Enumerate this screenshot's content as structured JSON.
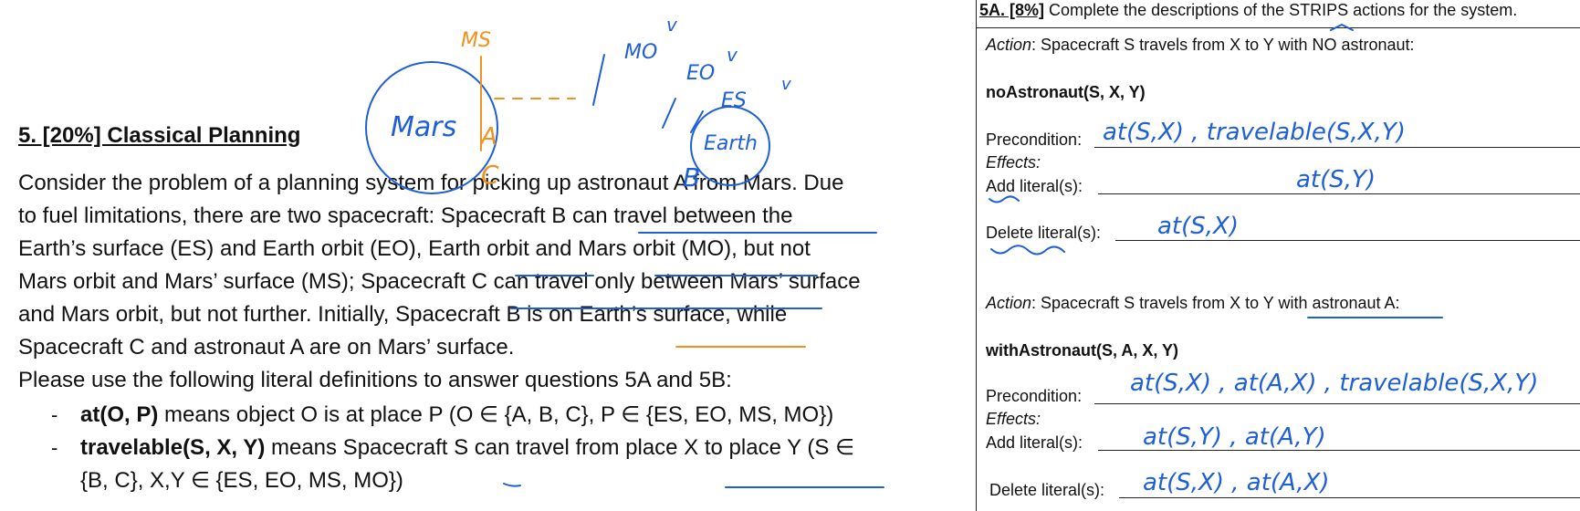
{
  "question": {
    "title": "5. [20%] Classical Planning",
    "paragraph": [
      "Consider the problem of a planning system for picking up astronaut A from Mars. Due",
      "to fuel limitations, there are two spacecraft: Spacecraft B can travel between the",
      "Earth’s surface (ES) and Earth orbit (EO), Earth orbit and Mars orbit (MO), but not",
      "Mars orbit and Mars’ surface (MS); Spacecraft C can travel only between Mars’ surface",
      "and Mars orbit, but not further. Initially, Spacecraft B is on Earth’s surface, while",
      "Spacecraft C and astronaut A are on Mars’ surface."
    ],
    "instruction": "Please use the following literal definitions to answer questions 5A and 5B:",
    "bullets": [
      {
        "dash": "-",
        "term": "at(O, P)",
        "text": " means object O is at place P (O ∈ {A, B, C}, P ∈ {ES, EO, MS, MO})"
      },
      {
        "dash": "-",
        "term": "travelable(S, X, Y)",
        "text": " means Spacecraft S can travel from place X to place Y (S ∈"
      }
    ],
    "bullet_cont": "{B, C}, X,Y ∈ {ES, EO, MS, MO})"
  },
  "sketch": {
    "mars": "Mars",
    "earth": "Earth",
    "ms": "MS",
    "mo": "MO",
    "eo": "EO",
    "es": "ES",
    "a": "A",
    "b": "B",
    "c": "C",
    "check": "v"
  },
  "panel": {
    "header_num": "5A. [8%]",
    "header_text": " Complete the descriptions of the STRIPS actions for the system.",
    "action1": {
      "label": "Action",
      "desc": ": Spacecraft S travels from X to Y with NO astronaut:"
    },
    "op1": "noAstronaut(S, X, Y)",
    "action2": {
      "label": "Action",
      "desc": ": Spacecraft S travels from X to Y with astronaut A:"
    },
    "op2": "withAstronaut(S, A, X, Y)",
    "labels": {
      "precondition": "Precondition:",
      "effects": "Effects:",
      "add": "Add literal(s):",
      "delete": "Delete literal(s):"
    },
    "answers1": {
      "pre": "at(S,X) , travelable(S,X,Y)",
      "add": "at(S,Y)",
      "del": "at(S,X)"
    },
    "answers2": {
      "pre": "at(S,X) , at(A,X) , travelable(S,X,Y)",
      "add": "at(S,Y) , at(A,Y)",
      "del": "at(S,X) , at(A,X)"
    }
  }
}
